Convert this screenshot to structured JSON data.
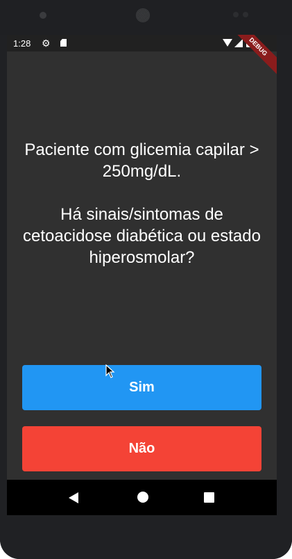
{
  "status_bar": {
    "time": "1:28",
    "icons": [
      "gear-icon",
      "sd-card-icon",
      "wifi-icon",
      "signal-icon",
      "battery-icon"
    ]
  },
  "debug_banner": "DEBUG",
  "question": {
    "line1": "Paciente com glicemia capilar > 250mg/dL.",
    "line2": "Há sinais/sintomas de cetoacidose diabética ou estado hiperosmolar?"
  },
  "buttons": {
    "yes_label": "Sim",
    "no_label": "Não"
  },
  "colors": {
    "background": "#303030",
    "yes_button": "#2196f3",
    "no_button": "#f44336"
  },
  "nav_bar": {
    "icons": [
      "back-icon",
      "home-icon",
      "recents-icon"
    ]
  }
}
